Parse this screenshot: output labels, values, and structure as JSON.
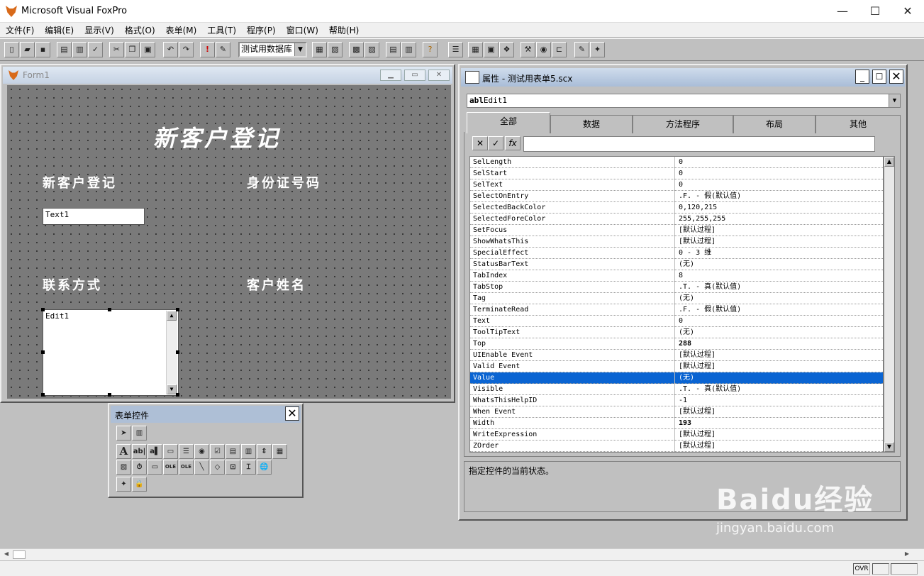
{
  "app": {
    "title": "Microsoft Visual FoxPro"
  },
  "menu": [
    "文件(F)",
    "编辑(E)",
    "显示(V)",
    "格式(O)",
    "表单(M)",
    "工具(T)",
    "程序(P)",
    "窗口(W)",
    "帮助(H)"
  ],
  "toolbar": {
    "database_select": "测试用数据库"
  },
  "form": {
    "window_title": "Form1",
    "heading": "新客户登记",
    "label1": "新客户登记",
    "label2": "身份证号码",
    "label3": "联系方式",
    "label4": "客户姓名",
    "text1": "Text1",
    "edit1": "Edit1"
  },
  "form_controls": {
    "title": "表单控件"
  },
  "properties": {
    "title": "属性 - 测试用表单5.scx",
    "object": "Edit1",
    "object_prefix": "abl",
    "tabs": [
      "全部",
      "数据",
      "方法程序",
      "布局",
      "其他"
    ],
    "rows": [
      {
        "name": "SelLength",
        "value": "0"
      },
      {
        "name": "SelStart",
        "value": "0"
      },
      {
        "name": "SelText",
        "value": "0"
      },
      {
        "name": "SelectOnEntry",
        "value": ".F. - 假(默认值)"
      },
      {
        "name": "SelectedBackColor",
        "value": "0,120,215"
      },
      {
        "name": "SelectedForeColor",
        "value": "255,255,255"
      },
      {
        "name": "SetFocus",
        "value": "[默认过程]"
      },
      {
        "name": "ShowWhatsThis",
        "value": "[默认过程]"
      },
      {
        "name": "SpecialEffect",
        "value": "0 - 3 维"
      },
      {
        "name": "StatusBarText",
        "value": "(无)"
      },
      {
        "name": "TabIndex",
        "value": "8"
      },
      {
        "name": "TabStop",
        "value": ".T. - 真(默认值)"
      },
      {
        "name": "Tag",
        "value": "(无)"
      },
      {
        "name": "TerminateRead",
        "value": ".F. - 假(默认值)"
      },
      {
        "name": "Text",
        "value": "0"
      },
      {
        "name": "ToolTipText",
        "value": "(无)"
      },
      {
        "name": "Top",
        "value": "288",
        "bold": true
      },
      {
        "name": "UIEnable Event",
        "value": "[默认过程]"
      },
      {
        "name": "Valid Event",
        "value": "[默认过程]"
      },
      {
        "name": "Value",
        "value": "(无)",
        "selected": true
      },
      {
        "name": "Visible",
        "value": ".T. - 真(默认值)"
      },
      {
        "name": "WhatsThisHelpID",
        "value": "-1"
      },
      {
        "name": "When Event",
        "value": "[默认过程]"
      },
      {
        "name": "Width",
        "value": "193",
        "bold": true
      },
      {
        "name": "WriteExpression",
        "value": "[默认过程]"
      },
      {
        "name": "ZOrder",
        "value": "[默认过程]"
      }
    ],
    "description": "指定控件的当前状态。"
  },
  "status": {
    "ovr": "OVR"
  },
  "watermark": {
    "brand": "Baidu经验",
    "url": "jingyan.baidu.com"
  }
}
